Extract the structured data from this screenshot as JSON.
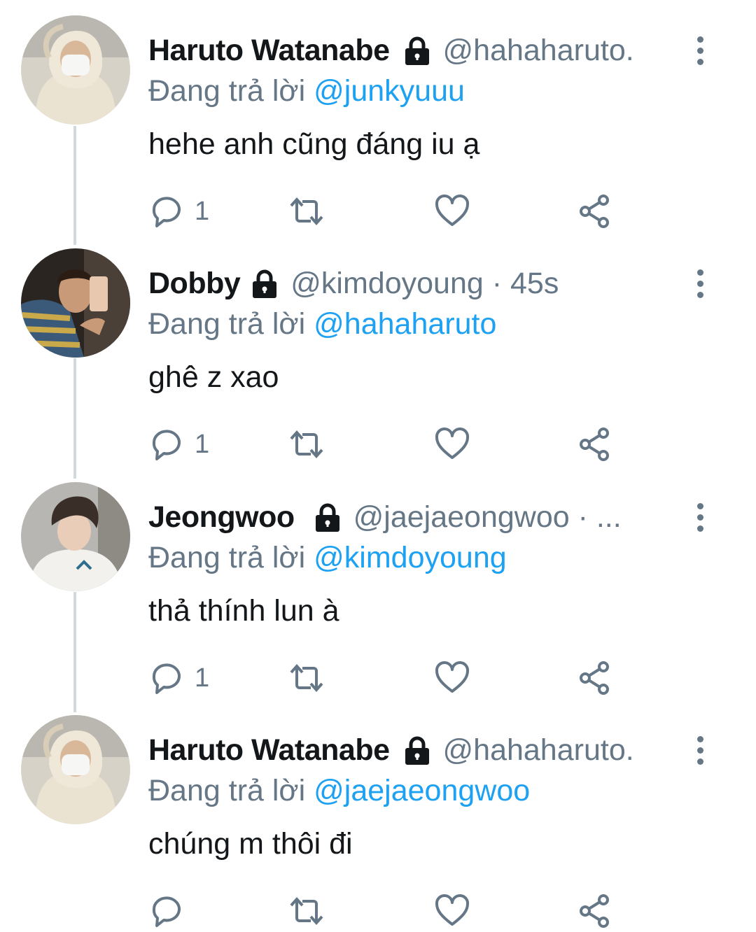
{
  "tweets": [
    {
      "name": "Haruto Watanabe",
      "handle": "@hahaharuto.",
      "reply_prefix": "Đang trả lời",
      "reply_to": "@junkyuuu",
      "text": "hehe anh cũng đáng iu ạ",
      "reply_count": "1"
    },
    {
      "name": "Dobby",
      "handle": "@kimdoyoung · 45s",
      "reply_prefix": "Đang trả lời",
      "reply_to": "@hahaharuto",
      "text": "ghê z xao",
      "reply_count": "1"
    },
    {
      "name": "Jeongwoo",
      "handle": "@jaejaeongwoo · ...",
      "reply_prefix": "Đang trả lời",
      "reply_to": "@kimdoyoung",
      "text": "thả thính lun à",
      "reply_count": "1"
    },
    {
      "name": "Haruto Watanabe",
      "handle": "@hahaharuto.",
      "reply_prefix": "Đang trả lời",
      "reply_to": "@jaejaeongwoo",
      "text": "chúng m thôi đi",
      "reply_count": ""
    }
  ],
  "icons": {
    "reply": "reply-bubble-icon",
    "retweet": "retweet-icon",
    "like": "heart-icon",
    "share": "share-icon",
    "lock": "lock-icon",
    "more": "more-vertical-icon"
  },
  "colors": {
    "text": "#14171a",
    "secondary": "#657786",
    "mention": "#1da1f2",
    "thread_line": "#cfd9de"
  }
}
